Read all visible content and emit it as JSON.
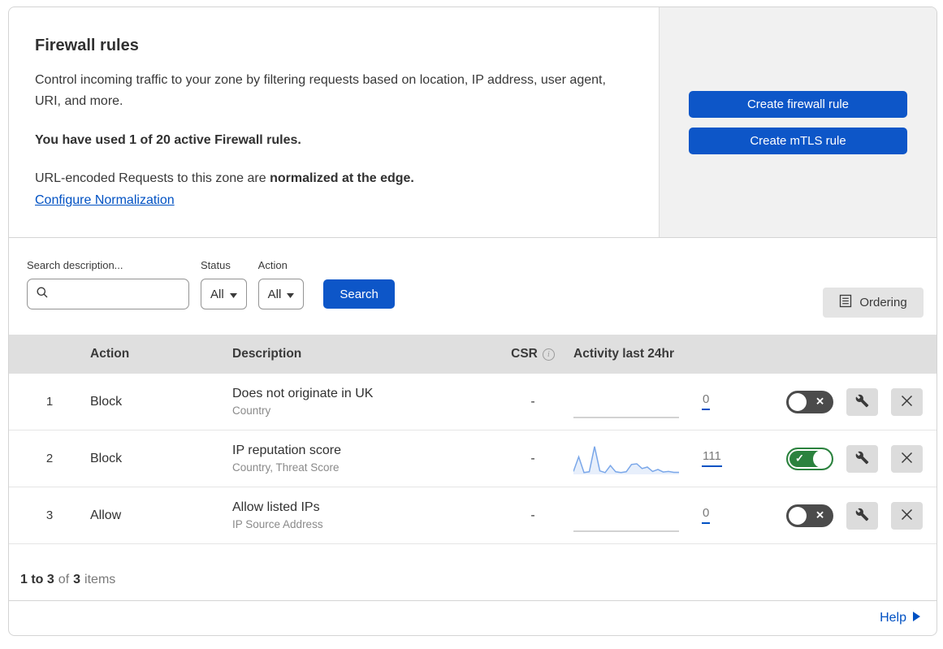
{
  "header": {
    "title": "Firewall rules",
    "description": "Control incoming traffic to your zone by filtering requests based on location, IP address, user agent, URI, and more.",
    "usage": "You have used 1 of 20 active Firewall rules.",
    "normalization_prefix": "URL-encoded Requests to this zone are ",
    "normalization_bold": "normalized at the edge.",
    "normalization_link": "Configure Normalization",
    "create_firewall_button": "Create firewall rule",
    "create_mtls_button": "Create mTLS rule"
  },
  "filters": {
    "search_label": "Search description...",
    "search_value": "",
    "status_label": "Status",
    "status_value": "All",
    "action_label": "Action",
    "action_value": "All",
    "search_button": "Search",
    "ordering_button": "Ordering"
  },
  "table": {
    "columns": {
      "action": "Action",
      "description": "Description",
      "csr": "CSR",
      "activity": "Activity last 24hr"
    },
    "rows": [
      {
        "index": "1",
        "action": "Block",
        "description": "Does not originate in UK",
        "criteria": "Country",
        "csr": "-",
        "activity_count": "0",
        "enabled": false,
        "activity_values": []
      },
      {
        "index": "2",
        "action": "Block",
        "description": "IP reputation score",
        "criteria": "Country, Threat Score",
        "csr": "-",
        "activity_count": "111",
        "enabled": true,
        "activity_values": [
          10,
          60,
          6,
          9,
          95,
          12,
          6,
          30,
          9,
          6,
          9,
          34,
          36,
          20,
          25,
          10,
          17,
          8,
          10,
          7,
          7
        ]
      },
      {
        "index": "3",
        "action": "Allow",
        "description": "Allow listed IPs",
        "criteria": "IP Source Address",
        "csr": "-",
        "activity_count": "0",
        "enabled": false,
        "activity_values": []
      }
    ]
  },
  "footer": {
    "range": "1 to 3",
    "of": "of",
    "total": "3",
    "items": "items"
  },
  "help": {
    "label": "Help"
  },
  "icons": {
    "search": "magnifying-glass",
    "dropdown_caret": "caret-down",
    "ordering": "list-box",
    "csr_info": "info-circle",
    "toggle_on": "check",
    "toggle_off": "x",
    "edit": "wrench",
    "delete": "x",
    "help": "caret-right"
  },
  "colors": {
    "button_blue": "#0d56c8",
    "link_blue": "#0051c3",
    "toggle_on_green": "#2b823e",
    "toggle_off_gray": "#4b4b4b",
    "side_panel_gray": "#f1f1f1",
    "table_header_gray": "#dfdfdf",
    "sparkline_blue": "#7aa7e9",
    "flat_line_gray": "#d2d2d2"
  }
}
